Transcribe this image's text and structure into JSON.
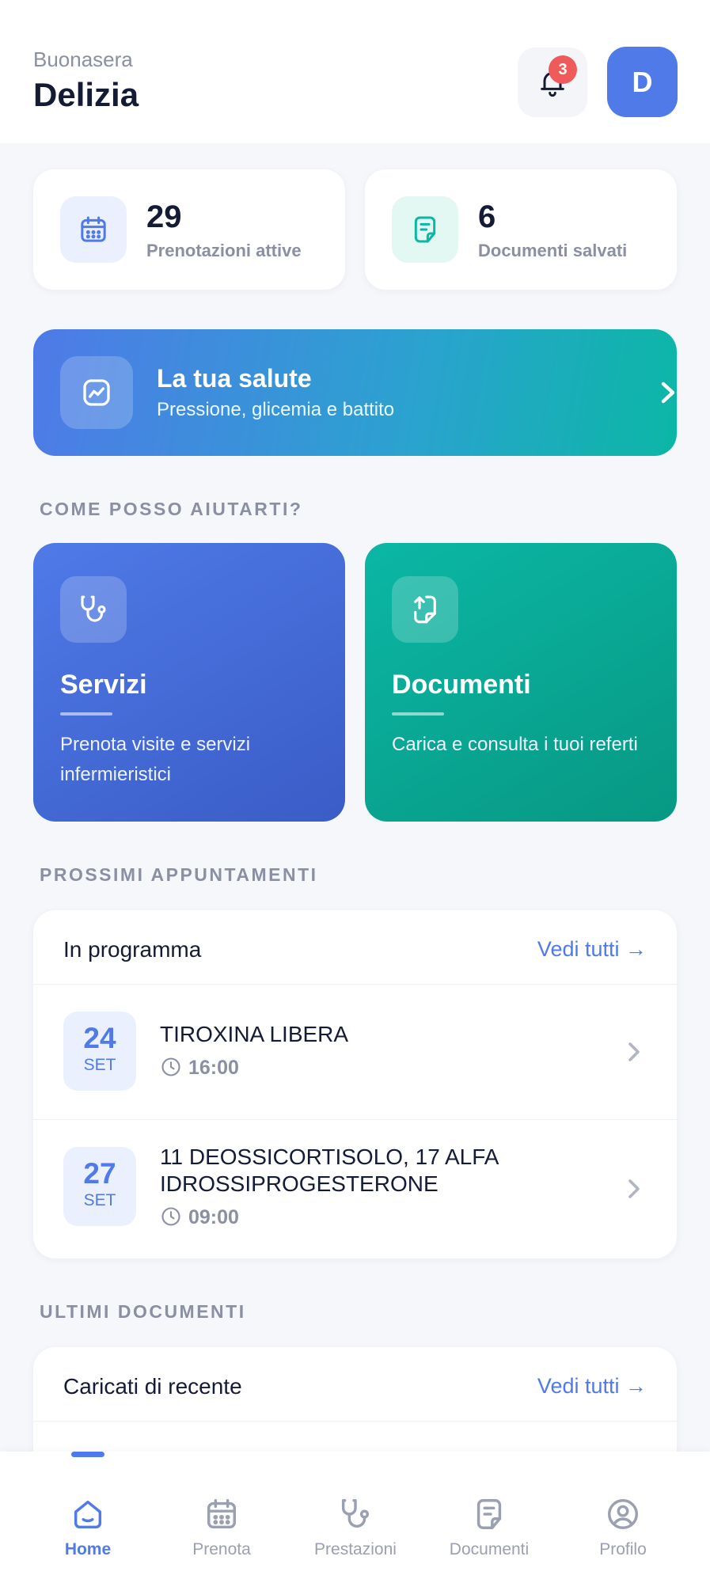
{
  "header": {
    "greeting": "Buonasera",
    "user_name": "Delizia",
    "notifications_count": "3",
    "avatar_initial": "D"
  },
  "stats": [
    {
      "value": "29",
      "label": "Prenotazioni attive",
      "icon": "calendar-icon"
    },
    {
      "value": "6",
      "label": "Documenti salvati",
      "icon": "document-icon"
    }
  ],
  "health_banner": {
    "title": "La tua salute",
    "subtitle": "Pressione, glicemia e battito",
    "icon": "chart-trend-icon"
  },
  "help_section": {
    "label": "COME POSSO AIUTARTI?",
    "cards": [
      {
        "title": "Servizi",
        "subtitle": "Prenota visite e servizi infermieristici",
        "icon": "stethoscope-icon"
      },
      {
        "title": "Documenti",
        "subtitle": "Carica e consulta i tuoi referti",
        "icon": "upload-document-icon"
      }
    ]
  },
  "appointments_section": {
    "label": "PROSSIMI APPUNTAMENTI",
    "panel_title": "In programma",
    "link": "Vedi tutti →",
    "items": [
      {
        "day": "24",
        "month": "SET",
        "name": "TIROXINA LIBERA",
        "time": "16:00"
      },
      {
        "day": "27",
        "month": "SET",
        "name": "11 DEOSSICORTISOLO, 17 ALFA IDROSSIPROGESTERONE",
        "time": "09:00"
      }
    ]
  },
  "documents_section": {
    "label": "ULTIMI DOCUMENTI",
    "panel_title": "Caricati di recente",
    "link": "Vedi tutti →"
  },
  "tabbar": {
    "items": [
      {
        "label": "Home",
        "icon": "home-icon",
        "active": true
      },
      {
        "label": "Prenota",
        "icon": "calendar-icon",
        "active": false
      },
      {
        "label": "Prestazioni",
        "icon": "stethoscope-icon",
        "active": false
      },
      {
        "label": "Documenti",
        "icon": "document-icon",
        "active": false
      },
      {
        "label": "Profilo",
        "icon": "profile-icon",
        "active": false
      }
    ]
  },
  "colors": {
    "primary": "#4f7ae8",
    "teal": "#0bb7a5",
    "badge": "#ef5b5b",
    "text": "#141b34",
    "muted": "#8a90a2",
    "background": "#f5f7fb"
  }
}
